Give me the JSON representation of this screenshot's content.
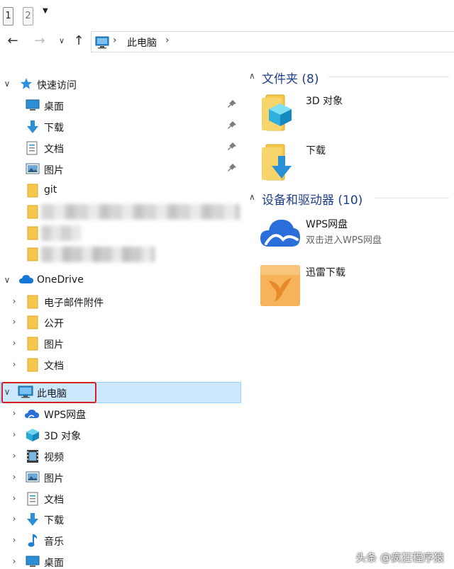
{
  "qat": {
    "key1": "1",
    "key2": "2"
  },
  "address": {
    "location": "此电脑"
  },
  "quick_access": {
    "label": "快速访问",
    "items": [
      {
        "label": "桌面",
        "pinned": true
      },
      {
        "label": "下载",
        "pinned": true
      },
      {
        "label": "文档",
        "pinned": true
      },
      {
        "label": "图片",
        "pinned": true
      },
      {
        "label": "git",
        "pinned": false
      }
    ]
  },
  "onedrive": {
    "label": "OneDrive",
    "items": [
      {
        "label": "电子邮件附件"
      },
      {
        "label": "公开"
      },
      {
        "label": "图片"
      },
      {
        "label": "文档"
      }
    ]
  },
  "this_pc": {
    "label": "此电脑",
    "items": [
      {
        "label": "WPS网盘"
      },
      {
        "label": "3D 对象"
      },
      {
        "label": "视频"
      },
      {
        "label": "图片"
      },
      {
        "label": "文档"
      },
      {
        "label": "下载"
      },
      {
        "label": "音乐"
      },
      {
        "label": "桌面"
      }
    ]
  },
  "content": {
    "folders_group": "文件夹 (8)",
    "folders": [
      {
        "name": "3D 对象",
        "icon": "3d-objects-folder-icon"
      },
      {
        "name": "下载",
        "icon": "downloads-folder-icon"
      }
    ],
    "devices_group": "设备和驱动器 (10)",
    "devices": [
      {
        "name": "WPS网盘",
        "subtitle": "双击进入WPS网盘",
        "icon": "wps-cloud-icon"
      },
      {
        "name": "迅雷下载",
        "subtitle": "",
        "icon": "xunlei-icon"
      }
    ]
  },
  "watermark": "头条 @疯狂程序猿",
  "colors": {
    "accent": "#1e3f8a",
    "selection": "#cce8ff",
    "highlight_box": "#d32020",
    "folder": "#f5c84c"
  }
}
